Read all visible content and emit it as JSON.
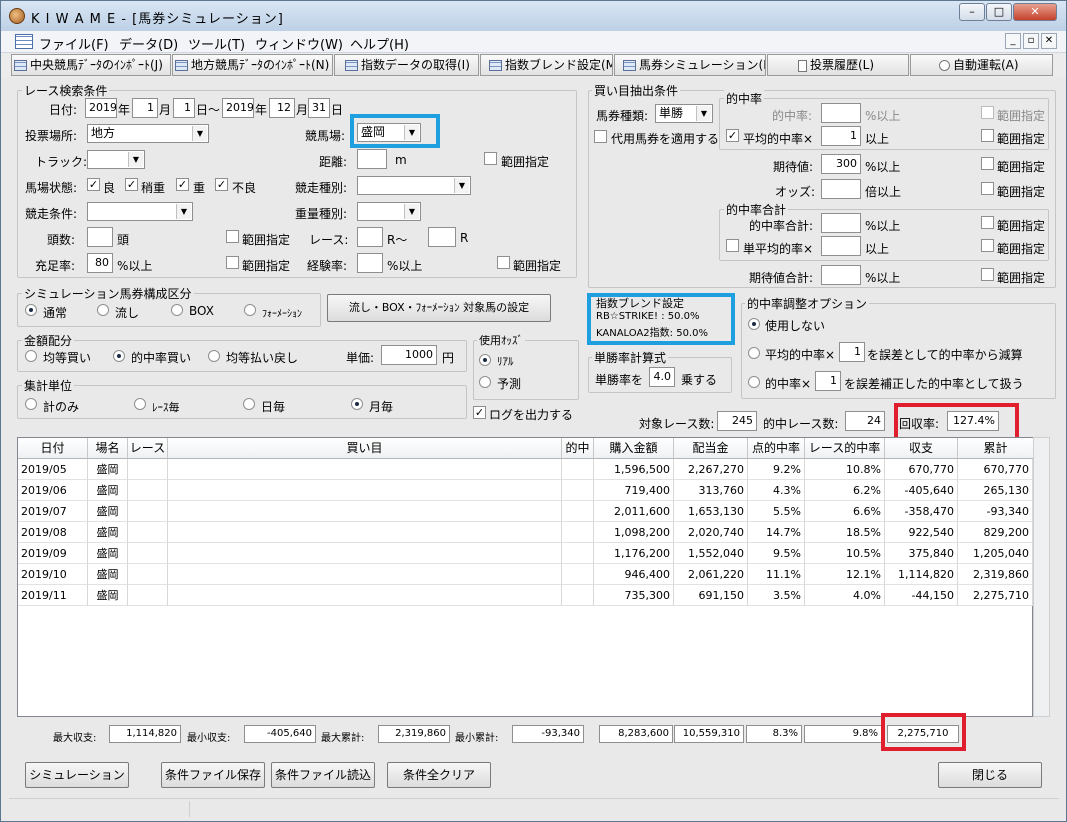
{
  "colors": {
    "highlight_blue": "#1e9fe0",
    "highlight_red": "#e01e2e"
  },
  "window": {
    "title": "K I W A M E - [馬券シミュレーション]",
    "min": "–",
    "max": "□",
    "close": "✕"
  },
  "menu": {
    "items": [
      "ファイル(F)",
      "データ(D)",
      "ツール(T)",
      "ウィンドウ(W)",
      "ヘルプ(H)"
    ],
    "mdi": [
      "_",
      "▫",
      "✕"
    ]
  },
  "toolbar": {
    "items": [
      "中央競馬ﾃﾞｰﾀのｲﾝﾎﾟｰﾄ(J)",
      "地方競馬ﾃﾞｰﾀのｲﾝﾎﾟｰﾄ(N)",
      "指数データの取得(I)",
      "指数ブレンド設定(M)",
      "馬券シミュレーション(B)",
      "投票履歴(L)",
      "自動運転(A)"
    ]
  },
  "race": {
    "legend": "レース検索条件",
    "date_label": "日付:",
    "from_y": "2019",
    "y1": "年",
    "from_m": "1",
    "m1": "月",
    "from_d": "1",
    "d1": "日～",
    "to_y": "2019",
    "y2": "年",
    "to_m": "12",
    "m2": "月",
    "to_d": "31",
    "d2": "日",
    "venue_label": "投票場所:",
    "venue": "地方",
    "course_label": "競馬場:",
    "course": "盛岡",
    "track_label": "トラック:",
    "distance_label": "距離:",
    "distance_unit": "m",
    "range": "範囲指定",
    "cond_label": "馬場状態:",
    "cond": [
      "良",
      "稍重",
      "重",
      "不良"
    ],
    "racetype_label": "競走種別:",
    "race_cond_label": "競走条件:",
    "weight_label": "重量種別:",
    "heads_label": "頭数:",
    "heads_unit": "頭",
    "race_label": "レース:",
    "race_r1": "R～",
    "race_r2": "R",
    "fill_label": "充足率:",
    "fill_val": "80",
    "fill_unit": "%以上",
    "exp_label": "経験率:",
    "exp_unit": "%以上"
  },
  "betsel": {
    "legend": "買い目抽出条件",
    "type_label": "馬券種類:",
    "type": "単勝",
    "sub": "代用馬券を適用する",
    "hit_legend": "的中率",
    "hit_label": "的中率:",
    "pct_up": "%以上",
    "avg_label": "平均的中率×",
    "avg_val": "1",
    "up": "以上",
    "range": "範囲指定",
    "ev_label": "期待値:",
    "ev_val": "300",
    "odds_label": "オッズ:",
    "odds_unit": "倍以上",
    "sum_legend": "的中率合計",
    "sum_label": "的中率合計:",
    "single_label": "単平均的率×",
    "evsum_label": "期待値合計:"
  },
  "simtype": {
    "legend": "シミュレーション馬券構成区分",
    "opts": [
      "通常",
      "流し",
      "BOX",
      "ﾌｫｰﾒｰｼｮﾝ"
    ],
    "btn": "流し・BOX・ﾌｫｰﾒｰｼｮﾝ 対象馬の設定"
  },
  "blend": {
    "legend": "指数ブレンド設定",
    "line1": "RB☆STRIKE! : 50.0%",
    "line2": "KANALOA2指数: 50.0%"
  },
  "adjust": {
    "legend": "的中率調整オプション",
    "opt1": "使用しない",
    "opt2a": "平均的中率×",
    "opt2v": "1",
    "opt2b": "を誤差として的中率から減算",
    "opt3a": "的中率×",
    "opt3v": "1",
    "opt3b": "を誤差補正した的中率として扱う"
  },
  "money": {
    "legend": "金額配分",
    "opts": [
      "均等買い",
      "的中率買い",
      "均等払い戻し"
    ],
    "unit_label": "単価:",
    "unit_val": "1000",
    "unit": "円"
  },
  "odds": {
    "legend": "使用ｵｯｽﾞ",
    "opts": [
      "ﾘｱﾙ",
      "予測"
    ]
  },
  "win": {
    "legend": "単勝率計算式",
    "label": "単勝率を",
    "val": "4.0",
    "unit": "乗する"
  },
  "agg": {
    "legend": "集計単位",
    "opts": [
      "計のみ",
      "ﾚｰｽ毎",
      "日毎",
      "月毎"
    ]
  },
  "log": {
    "label": "ログを出力する"
  },
  "summary": {
    "races_label": "対象レース数:",
    "races": "245",
    "hits_label": "的中レース数:",
    "hits": "24",
    "roi_label": "回収率:",
    "roi": "127.4%"
  },
  "table": {
    "headers": [
      "日付",
      "場名",
      "レース",
      "買い目",
      "的中",
      "購入金額",
      "配当金",
      "点的中率",
      "レース的中率",
      "収支",
      "累計"
    ],
    "rows": [
      [
        "2019/05",
        "盛岡",
        "",
        "",
        "",
        "1,596,500",
        "2,267,270",
        "9.2%",
        "10.8%",
        "670,770",
        "670,770"
      ],
      [
        "2019/06",
        "盛岡",
        "",
        "",
        "",
        "719,400",
        "313,760",
        "4.3%",
        "6.2%",
        "-405,640",
        "265,130"
      ],
      [
        "2019/07",
        "盛岡",
        "",
        "",
        "",
        "2,011,600",
        "1,653,130",
        "5.5%",
        "6.6%",
        "-358,470",
        "-93,340"
      ],
      [
        "2019/08",
        "盛岡",
        "",
        "",
        "",
        "1,098,200",
        "2,020,740",
        "14.7%",
        "18.5%",
        "922,540",
        "829,200"
      ],
      [
        "2019/09",
        "盛岡",
        "",
        "",
        "",
        "1,176,200",
        "1,552,040",
        "9.5%",
        "10.5%",
        "375,840",
        "1,205,040"
      ],
      [
        "2019/10",
        "盛岡",
        "",
        "",
        "",
        "946,400",
        "2,061,220",
        "11.1%",
        "12.1%",
        "1,114,820",
        "2,319,860"
      ],
      [
        "2019/11",
        "盛岡",
        "",
        "",
        "",
        "735,300",
        "691,150",
        "3.5%",
        "4.0%",
        "-44,150",
        "2,275,710"
      ]
    ]
  },
  "footer": {
    "maxp_label": "最大収支:",
    "maxp": "1,114,820",
    "minp_label": "最小収支:",
    "minp": "-405,640",
    "maxc_label": "最大累計:",
    "maxc": "2,319,860",
    "minc_label": "最小累計:",
    "minc": "-93,340",
    "buy": "8,283,600",
    "pay": "10,559,310",
    "pt": "8.3%",
    "race": "9.8%",
    "total": "2,275,710"
  },
  "buttons": {
    "sim": "シミュレーション",
    "save": "条件ファイル保存",
    "load": "条件ファイル読込",
    "clear": "条件全クリア",
    "close": "閉じる"
  }
}
